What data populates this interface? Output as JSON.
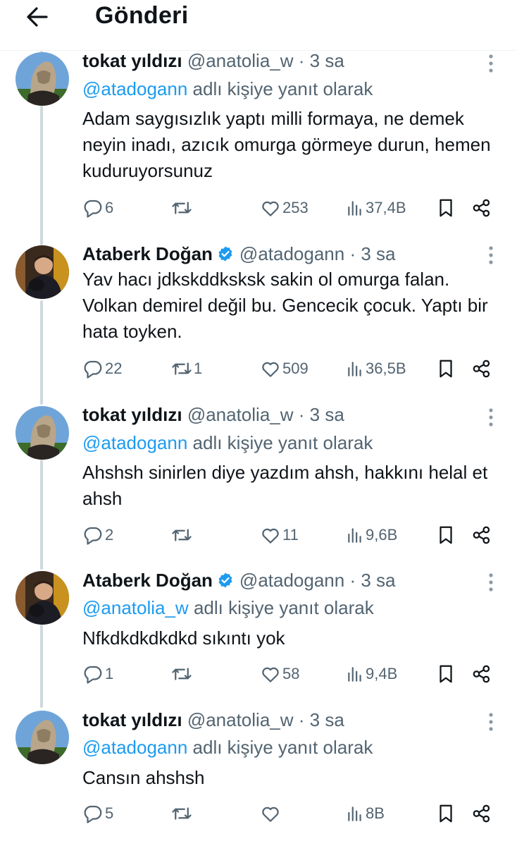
{
  "header": {
    "title": "Gönderi"
  },
  "reply_suffix": "adlı kişiye yanıt olarak",
  "tweets": [
    {
      "name": "tokat yıldızı",
      "handle": "@anatolia_w",
      "dot": "·",
      "time": "3 sa",
      "verified": false,
      "reply_to": "@atadogann",
      "text": "Adam saygısızlık yaptı milli formaya, ne demek neyin inadı, azıcık omurga görmeye durun, hemen kuduruyorsunuz",
      "replies": "6",
      "retweets": "",
      "likes": "253",
      "views": "37,4B"
    },
    {
      "name": "Ataberk Doğan",
      "handle": "@atadogann",
      "dot": "·",
      "time": "3 sa",
      "verified": true,
      "reply_to": "",
      "text": "Yav hacı jdkskddksksk sakin ol omurga falan. Volkan demirel değil bu. Gencecik çocuk. Yaptı bir hata toyken.",
      "replies": "22",
      "retweets": "1",
      "likes": "509",
      "views": "36,5B"
    },
    {
      "name": "tokat yıldızı",
      "handle": "@anatolia_w",
      "dot": "·",
      "time": "3 sa",
      "verified": false,
      "reply_to": "@atadogann",
      "text": "Ahshsh sinirlen diye yazdım ahsh, hakkını helal et ahsh",
      "replies": "2",
      "retweets": "",
      "likes": "11",
      "views": "9,6B"
    },
    {
      "name": "Ataberk Doğan",
      "handle": "@atadogann",
      "dot": "·",
      "time": "3 sa",
      "verified": true,
      "reply_to": "@anatolia_w",
      "text": "Nfkdkdkdkdkd sıkıntı yok",
      "replies": "1",
      "retweets": "",
      "likes": "58",
      "views": "9,4B"
    },
    {
      "name": "tokat yıldızı",
      "handle": "@anatolia_w",
      "dot": "·",
      "time": "3 sa",
      "verified": false,
      "reply_to": "@atadogann",
      "text": "Cansın ahshsh",
      "replies": "5",
      "retweets": "",
      "likes": "",
      "views": "8B"
    }
  ],
  "colors": {
    "text": "#0f1419",
    "secondary": "#536471",
    "accent": "#1d9bf0",
    "thread_line": "#cfd9de"
  },
  "icons": [
    "back-arrow-icon",
    "verified-badge-icon",
    "more-icon",
    "reply-icon",
    "retweet-icon",
    "like-icon",
    "views-icon",
    "bookmark-icon",
    "share-icon"
  ]
}
